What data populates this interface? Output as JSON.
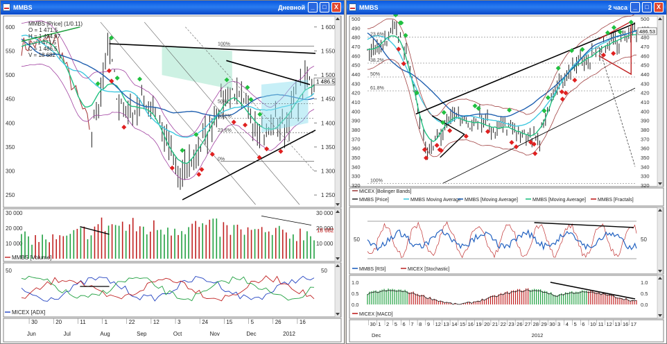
{
  "windows": [
    {
      "title": "MMBS",
      "timeframe": "Дневной",
      "controls": {
        "minimize": "_",
        "maximize": "□",
        "close": "X"
      },
      "price_legend": [
        "MMBS [Price] (1/0.11)",
        "O = 1 471.5",
        "H = 1 494.97",
        "L = 1 471.5",
        "C = 1 486.5",
        "V = 18 682"
      ],
      "fib_labels": [
        "100%",
        "50%",
        "38.2%",
        "23.6%",
        "0%"
      ],
      "volume_legend": "MMBS [Volume]",
      "adx_legend": "MICEX [ADX]",
      "price_axis_right": [
        "1 600",
        "1 550",
        "1 500",
        "1 450",
        "1 400",
        "1 350",
        "1 300",
        "1 250"
      ],
      "volume_axis": [
        "30 000",
        "20 000",
        "10 000"
      ],
      "adx_axis": [
        "50"
      ],
      "date_axis": {
        "days": [
          "30",
          "20",
          "11",
          "1",
          "22",
          "12",
          "3",
          "24",
          "15",
          "5",
          "26",
          "16"
        ],
        "months": [
          "Jun",
          "Jul",
          "Aug",
          "Sep",
          "Oct",
          "Nov",
          "Dec",
          "2012"
        ]
      }
    },
    {
      "title": "MMBS",
      "timeframe": "2 часа",
      "controls": {
        "minimize": "_",
        "maximize": "□",
        "close": "X"
      },
      "fib_labels": [
        "23.6%",
        "38.2%",
        "50%",
        "61.8%",
        "100%"
      ],
      "legend_items": [
        {
          "label": "MICEX [Bolinger Bands]",
          "color": "#a04040"
        },
        {
          "label": "MMBS [Price]",
          "color": "#303030"
        },
        {
          "label": "MMBS Moving Average",
          "color": "#40c8e0"
        },
        {
          "label": "MMBS [Moving Average]",
          "color": "#2060b0"
        },
        {
          "label": "MMBS [Moving Average]",
          "color": "#20c080"
        },
        {
          "label": "MMBS [Fractals]",
          "color": "#c02020"
        }
      ],
      "rsi_legend": [
        "MMBS [RSI]",
        "MICEX [Stochastic]"
      ],
      "macd_legend": "MICEX [MACD]",
      "price_axis": [
        "500",
        "490",
        "480",
        "470",
        "460",
        "450",
        "440",
        "430",
        "420",
        "410",
        "400",
        "390",
        "380",
        "370",
        "360",
        "350",
        "340",
        "330",
        "320"
      ],
      "rsi_axis": [
        "50"
      ],
      "macd_axis": [
        "1.0",
        "0.5",
        "0.0"
      ],
      "date_axis": {
        "days": [
          "30",
          "1",
          "2",
          "5",
          "6",
          "7",
          "8",
          "9",
          "12",
          "13",
          "14",
          "15",
          "16",
          "19",
          "20",
          "21",
          "22",
          "23",
          "26",
          "27",
          "28",
          "29",
          "30",
          "3",
          "4",
          "5",
          "6",
          "10",
          "11",
          "12",
          "13",
          "16",
          "17"
        ],
        "months": [
          "Dec",
          "2012"
        ]
      }
    }
  ],
  "chart_data": [
    {
      "type": "line",
      "title": "MMBS",
      "xlabel": "",
      "ylabel": "",
      "x": [
        "Jun",
        "Jul",
        "Aug",
        "Sep",
        "Oct",
        "Nov",
        "Dec",
        "2012"
      ],
      "series": [
        {
          "name": "MMBS [Price]",
          "values": [
            1560,
            1570,
            1530,
            1420,
            1290,
            1430,
            1380,
            1486.5
          ]
        }
      ],
      "ylim": [
        1230,
        1620
      ],
      "grid": false
    },
    {
      "type": "bar",
      "title": "MMBS [Volume]",
      "categories": [
        "Jun",
        "Jul",
        "Aug",
        "Sep",
        "Oct",
        "Nov",
        "Dec",
        "2012"
      ],
      "series": [
        {
          "name": "MMBS [Volume]",
          "values": [
            15000,
            14000,
            25000,
            22000,
            24000,
            21000,
            18000,
            18682
          ]
        }
      ],
      "ylim": [
        0,
        30000
      ]
    },
    {
      "type": "line",
      "title": "MMBS",
      "xlabel": "",
      "ylabel": "",
      "x": [
        "Dec",
        "2012"
      ],
      "series": [
        {
          "name": "MMBS [Price]",
          "values": [
            480,
            380,
            370,
            360,
            420,
            455,
            486.53
          ]
        }
      ],
      "ylim": [
        320,
        500
      ],
      "grid": false
    },
    {
      "type": "bar",
      "title": "MICEX [MACD]",
      "categories": [
        "Dec",
        "2012"
      ],
      "series": [
        {
          "name": "MICEX [MACD]",
          "values": [
            1.0,
            0.0,
            0.9,
            0.2
          ]
        }
      ],
      "ylim": [
        -0.1,
        1.1
      ]
    }
  ]
}
